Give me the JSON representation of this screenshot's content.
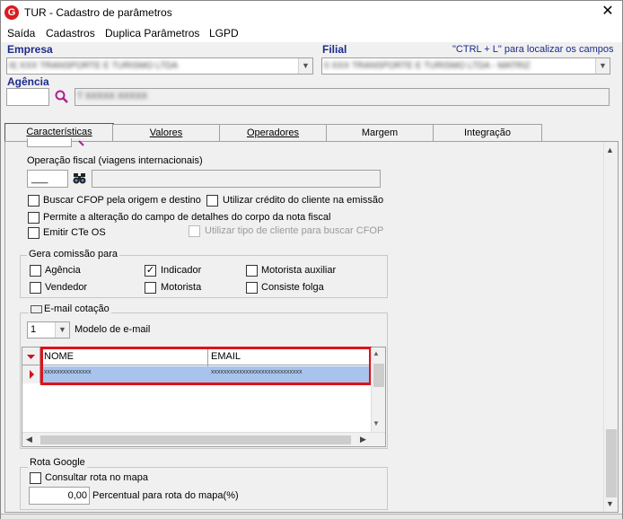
{
  "window": {
    "title": "TUR - Cadastro de parâmetros",
    "close_glyph": "✕",
    "app_icon_letter": "G"
  },
  "menu": [
    "Saída",
    "Cadastros",
    "Duplica Parâmetros",
    "LGPD"
  ],
  "header": {
    "empresa_label": "Empresa",
    "empresa_value": "0(  XXX TRANSPORTE E TURISMO LTDA",
    "filial_label": "Filial",
    "filial_value": "0  XXX TRANSPORTE E TURISMO LTDA - MATRIZ",
    "hint": "\"CTRL + L\" para localizar os campos",
    "agencia_label": "Agência",
    "agencia_code": "",
    "agencia_name": "T   XXXXX XXXXX"
  },
  "tabs": [
    "Características",
    "Valores",
    "Operadores",
    "Margem",
    "Integração"
  ],
  "operacao_fiscal": {
    "label": "Operação fiscal (viagens internacionais)",
    "code": "___"
  },
  "checks_top": [
    {
      "label": "Buscar CFOP pela origem e destino",
      "checked": false
    },
    {
      "label": "Utilizar crédito do cliente na emissão",
      "checked": false
    },
    {
      "label": "Permite a alteração do campo de detalhes do corpo da nota fiscal",
      "checked": false
    },
    {
      "label": "Emitir CTe OS",
      "checked": false
    },
    {
      "label": "Utilizar tipo de cliente para buscar CFOP",
      "checked": false,
      "disabled": true
    }
  ],
  "comissao": {
    "title": "Gera comissão para",
    "items": [
      {
        "label": "Agência",
        "checked": false
      },
      {
        "label": "Indicador",
        "checked": true
      },
      {
        "label": "Motorista auxiliar",
        "checked": false
      },
      {
        "label": "Vendedor",
        "checked": false
      },
      {
        "label": "Motorista",
        "checked": false
      },
      {
        "label": "Consiste folga",
        "checked": false
      }
    ]
  },
  "email": {
    "title": "E-mail cotação",
    "modelo_value": "1",
    "modelo_label": "Modelo de e-mail",
    "columns": [
      "NOME",
      "EMAIL"
    ],
    "rows": [
      {
        "nome": "xxxxxxxxxxxxxxx",
        "email": "xxxxxxxxxxxxxxxxxxxxxxxxxxxxx"
      }
    ]
  },
  "rota": {
    "title": "Rota Google",
    "consultar_label": "Consultar rota no mapa",
    "percentual_value": "0,00",
    "percentual_label": "Percentual para rota do mapa(%)"
  },
  "colors": {
    "accent": "#1c2b8a",
    "highlight": "#e0121a",
    "selection": "#a8c4ec"
  }
}
